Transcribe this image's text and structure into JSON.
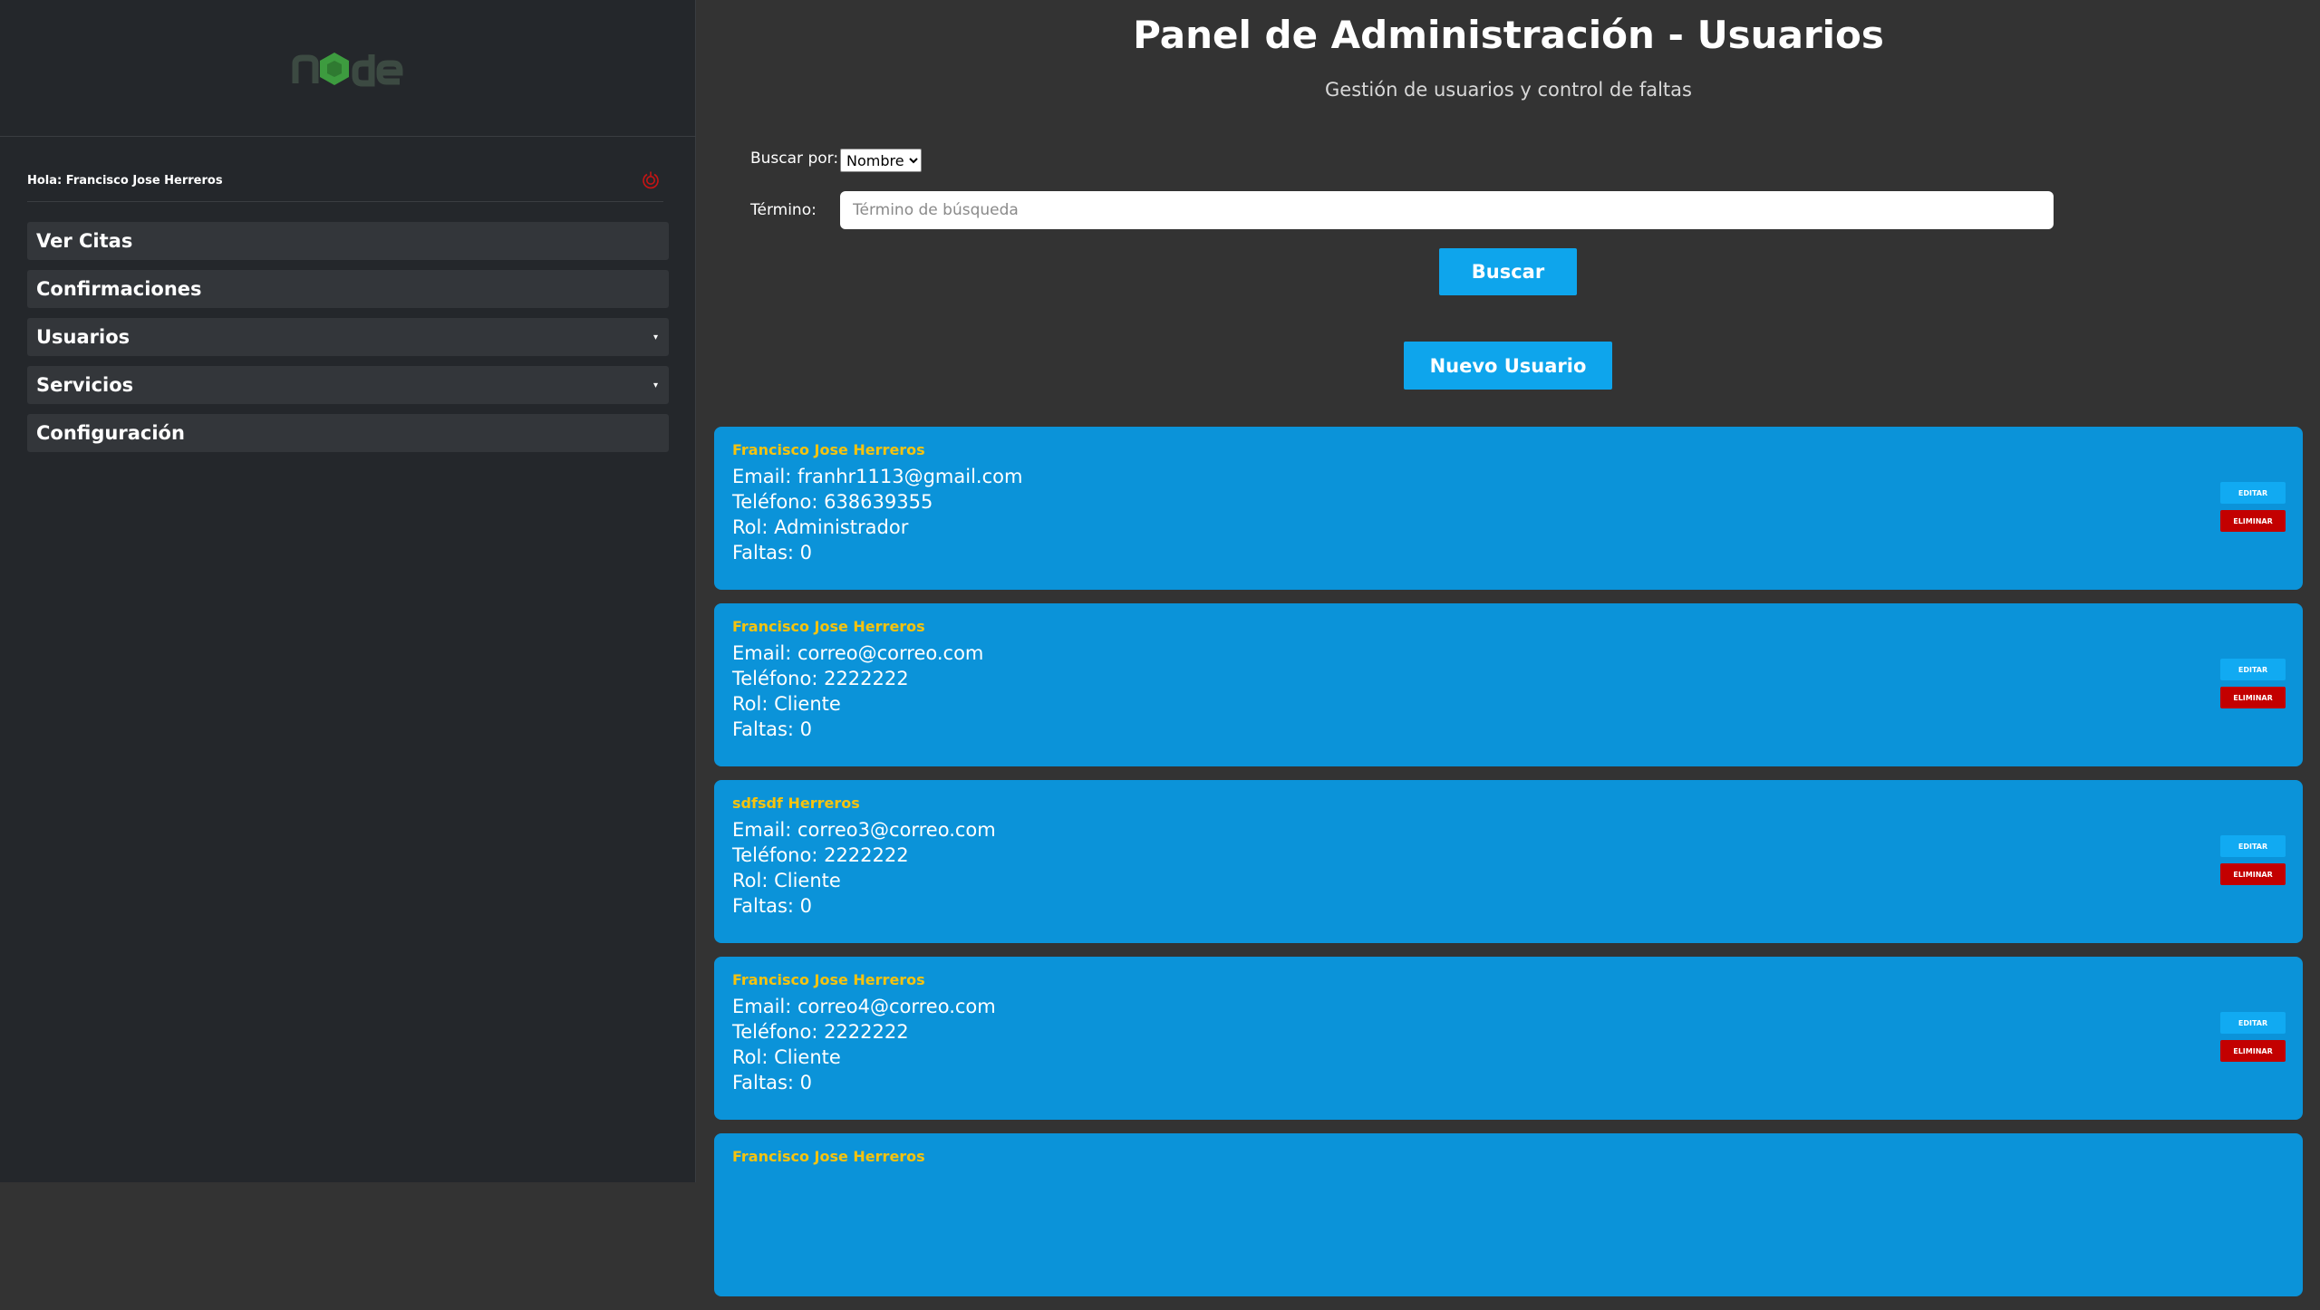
{
  "sidebar": {
    "greeting": "Hola: Francisco Jose Herreros",
    "items": [
      {
        "label": "Ver Citas",
        "caret": ""
      },
      {
        "label": "Confirmaciones",
        "caret": ""
      },
      {
        "label": "Usuarios",
        "caret": "▾"
      },
      {
        "label": "Servicios",
        "caret": "▾"
      },
      {
        "label": "Configuración",
        "caret": ""
      }
    ]
  },
  "header": {
    "title": "Panel de Administración - Usuarios",
    "subtitle": "Gestión de usuarios y control de faltas"
  },
  "search": {
    "search_by_label": "Buscar por:",
    "search_by_value": "Nombre",
    "term_label": "Término:",
    "placeholder": "Término de búsqueda",
    "button_label": "Buscar"
  },
  "new_user_label": "Nuevo Usuario",
  "users": [
    {
      "name": "Francisco Jose Herreros",
      "email": "Email: franhr1113@gmail.com",
      "phone": "Teléfono: 638639355",
      "role": "Rol: Administrador",
      "absences": "Faltas: 0",
      "edit": "EDITAR",
      "delete": "ELIMINAR"
    },
    {
      "name": "Francisco Jose Herreros",
      "email": "Email: correo@correo.com",
      "phone": "Teléfono: 2222222",
      "role": "Rol: Cliente",
      "absences": "Faltas: 0",
      "edit": "EDITAR",
      "delete": "ELIMINAR"
    },
    {
      "name": "sdfsdf Herreros",
      "email": "Email: correo3@correo.com",
      "phone": "Teléfono: 2222222",
      "role": "Rol: Cliente",
      "absences": "Faltas: 0",
      "edit": "EDITAR",
      "delete": "ELIMINAR"
    },
    {
      "name": "Francisco Jose Herreros",
      "email": "Email: correo4@correo.com",
      "phone": "Teléfono: 2222222",
      "role": "Rol: Cliente",
      "absences": "Faltas: 0",
      "edit": "EDITAR",
      "delete": "ELIMINAR"
    },
    {
      "name": "Francisco Jose Herreros",
      "email": "",
      "phone": "",
      "role": "",
      "absences": "",
      "edit": "",
      "delete": ""
    }
  ],
  "colors": {
    "accent": "#0ea5ec",
    "card": "#0b93d9",
    "user_name": "#f5c30f",
    "danger": "#c30000",
    "sidebar_bg": "#24272b",
    "main_bg": "#333333"
  },
  "icons": {
    "logo": "node-logo",
    "power": "power-icon",
    "caret": "caret-down-icon"
  }
}
